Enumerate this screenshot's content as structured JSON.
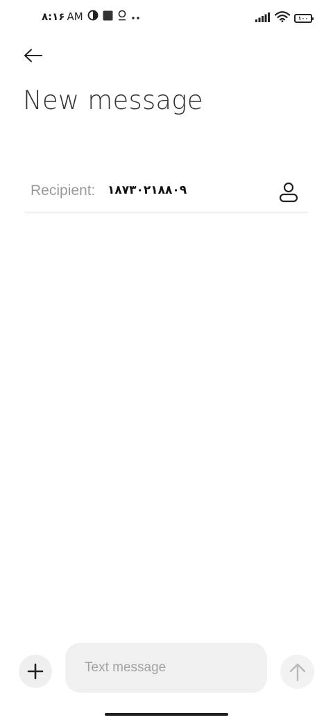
{
  "status_bar": {
    "time": "۸:۱۶",
    "ampm": "AM",
    "icons": [
      "data-saver-icon",
      "stop-square-icon",
      "location-icon",
      "more-dots-icon"
    ],
    "right_icons": [
      "signal-icon",
      "wifi-icon",
      "battery-icon"
    ],
    "battery_level": "۱۰۰"
  },
  "header": {
    "back_icon": "arrow-left-icon",
    "title": "New message"
  },
  "recipient": {
    "label": "Recipient:",
    "value": "۱۸۷۳۰۲۱۸۸۰۹",
    "contact_icon": "person-outline-icon"
  },
  "composer": {
    "add_icon": "plus-icon",
    "placeholder": "Text message",
    "value": "",
    "send_icon": "arrow-up-icon"
  },
  "colors": {
    "background": "#ffffff",
    "title_text": "#333333",
    "label_text": "#999999",
    "input_background": "#f0f0f0",
    "send_icon_disabled": "#b8b8b8"
  }
}
